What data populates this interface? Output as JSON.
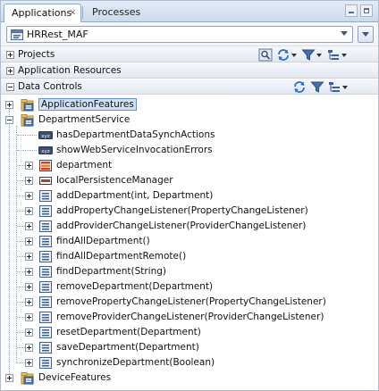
{
  "tabs": [
    {
      "label": "Applications"
    },
    {
      "label": "Processes"
    }
  ],
  "application_selector": {
    "value": "HRRest_MAF"
  },
  "panels": {
    "projects": {
      "label": "Projects"
    },
    "application_resources": {
      "label": "Application Resources"
    },
    "data_controls": {
      "label": "Data Controls"
    }
  },
  "tree": [
    {
      "label": "ApplicationFeatures",
      "level": 0,
      "expander": "plus",
      "icon": "data-control-folder-icon",
      "selected": true
    },
    {
      "label": "DepartmentService",
      "level": 0,
      "expander": "minus",
      "icon": "data-control-folder-icon"
    },
    {
      "label": "hasDepartmentDataSynchActions",
      "level": 1,
      "expander": "none",
      "icon": "attribute-icon"
    },
    {
      "label": "showWebServiceInvocationErrors",
      "level": 1,
      "expander": "none",
      "icon": "attribute-icon"
    },
    {
      "label": "department",
      "level": 1,
      "expander": "plus",
      "icon": "collection-icon"
    },
    {
      "label": "localPersistenceManager",
      "level": 1,
      "expander": "plus",
      "icon": "object-icon"
    },
    {
      "label": "addDepartment(int, Department)",
      "level": 1,
      "expander": "plus",
      "icon": "method-icon"
    },
    {
      "label": "addPropertyChangeListener(PropertyChangeListener)",
      "level": 1,
      "expander": "plus",
      "icon": "method-icon"
    },
    {
      "label": "addProviderChangeListener(ProviderChangeListener)",
      "level": 1,
      "expander": "plus",
      "icon": "method-icon"
    },
    {
      "label": "findAllDepartment()",
      "level": 1,
      "expander": "plus",
      "icon": "method-icon"
    },
    {
      "label": "findAllDepartmentRemote()",
      "level": 1,
      "expander": "plus",
      "icon": "method-icon"
    },
    {
      "label": "findDepartment(String)",
      "level": 1,
      "expander": "plus",
      "icon": "method-icon"
    },
    {
      "label": "removeDepartment(Department)",
      "level": 1,
      "expander": "plus",
      "icon": "method-icon"
    },
    {
      "label": "removePropertyChangeListener(PropertyChangeListener)",
      "level": 1,
      "expander": "plus",
      "icon": "method-icon"
    },
    {
      "label": "removeProviderChangeListener(ProviderChangeListener)",
      "level": 1,
      "expander": "plus",
      "icon": "method-icon"
    },
    {
      "label": "resetDepartment(Department)",
      "level": 1,
      "expander": "plus",
      "icon": "method-icon"
    },
    {
      "label": "saveDepartment(Department)",
      "level": 1,
      "expander": "plus",
      "icon": "method-icon"
    },
    {
      "label": "synchronizeDepartment(Boolean)",
      "level": 1,
      "expander": "plus",
      "icon": "method-icon"
    },
    {
      "label": "DeviceFeatures",
      "level": 0,
      "expander": "plus",
      "icon": "data-control-folder-icon"
    }
  ],
  "colors": {
    "selection": "#cfe0f7",
    "accent": "#3d5a86"
  }
}
